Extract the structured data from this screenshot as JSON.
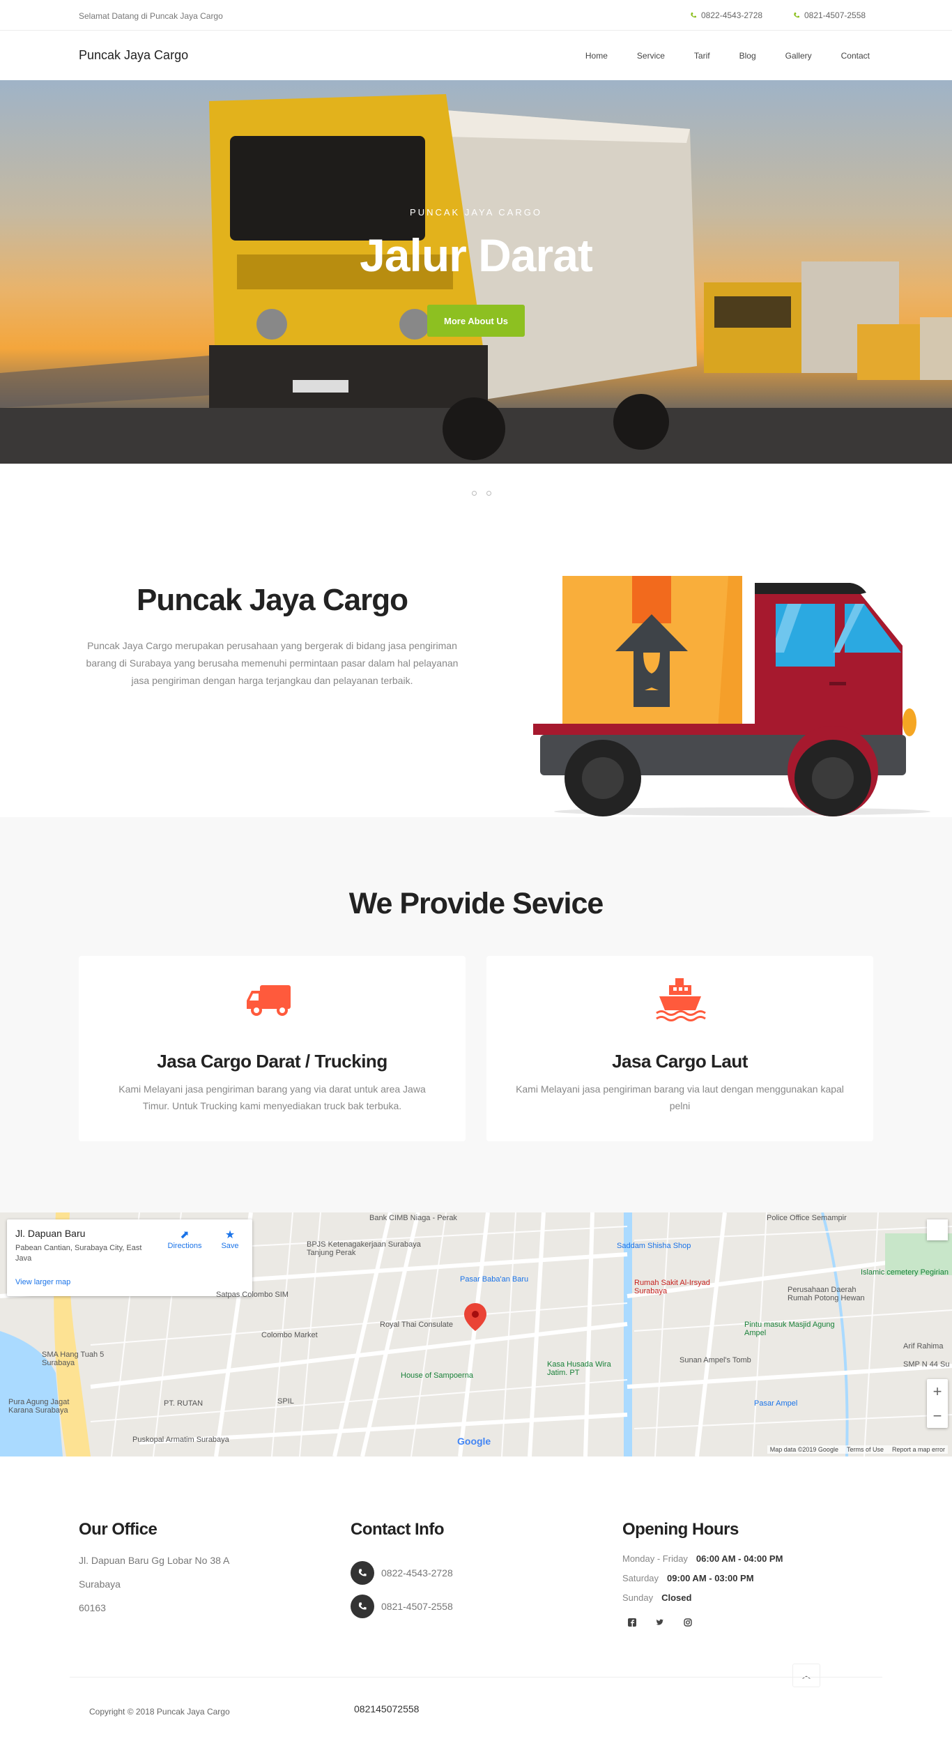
{
  "topbar": {
    "welcome": "Selamat Datang di Puncak Jaya Cargo",
    "phone1": "0822-4543-2728",
    "phone2": "0821-4507-2558"
  },
  "nav": {
    "brand": "Puncak Jaya Cargo",
    "items": [
      "Home",
      "Service",
      "Tarif",
      "Blog",
      "Gallery",
      "Contact"
    ]
  },
  "hero": {
    "kicker": "PUNCAK JAYA CARGO",
    "title": "Jalur Darat",
    "cta": "More About Us"
  },
  "about": {
    "title": "Puncak Jaya Cargo",
    "text": "Puncak Jaya Cargo merupakan perusahaan yang bergerak di bidang jasa pengiriman barang di Surabaya yang berusaha memenuhi permintaan pasar dalam hal pelayanan jasa pengiriman dengan harga terjangkau dan pelayanan terbaik."
  },
  "services": {
    "heading": "We Provide Sevice",
    "cards": [
      {
        "icon": "truck-icon",
        "title": "Jasa Cargo Darat / Trucking",
        "text": "Kami Melayani jasa pengiriman barang yang via darat untuk area Jawa Timur. Untuk Trucking kami menyediakan truck bak terbuka."
      },
      {
        "icon": "ship-icon",
        "title": "Jasa Cargo Laut",
        "text": "Kami Melayani jasa pengiriman barang via laut dengan menggunakan kapal pelni"
      }
    ]
  },
  "map": {
    "place": "Jl. Dapuan Baru",
    "address": "Pabean Cantian, Surabaya City, East Java",
    "larger": "View larger map",
    "directions": "Directions",
    "save": "Save",
    "labels": [
      "Bank CIMB Niaga - Perak",
      "BPJS Ketenagakerjaan Surabaya Tanjung Perak",
      "Satpas Colombo SIM",
      "Colombo Market",
      "Royal Thai Consulate",
      "Pasar Baba'an Baru",
      "Saddam Shisha Shop",
      "Rumah Sakit Al-Irsyad Surabaya",
      "Perusahaan Daerah Rumah Potong Hewan",
      "Pintu masuk Masjid Agung Ampel",
      "Sunan Ampel's Tomb",
      "Kasa Husada Wira Jatim. PT",
      "House of Sampoerna",
      "SMA Hang Tuah 5 Surabaya",
      "Pura Agung Jagat Karana Surabaya",
      "PT. RUTAN",
      "SPIL",
      "Puskopal Armatim Surabaya",
      "Pasar Ampel",
      "Police Office Semampir",
      "Islamic cemetery Pegirian",
      "Arif Rahima",
      "SMP N 44 Su"
    ],
    "attribution": [
      "Map data ©2019 Google",
      "Terms of Use",
      "Report a map error"
    ],
    "google": "Google"
  },
  "footer": {
    "office": {
      "title": "Our Office",
      "lines": [
        "Jl. Dapuan Baru Gg Lobar No 38 A",
        "Surabaya",
        "60163"
      ]
    },
    "contact": {
      "title": "Contact Info",
      "phones": [
        "0822-4543-2728",
        "0821-4507-2558"
      ]
    },
    "hours": {
      "title": "Opening Hours",
      "rows": [
        {
          "day": "Monday - Friday",
          "time": "06:00 AM - 04:00 PM"
        },
        {
          "day": "Saturday",
          "time": "09:00 AM - 03:00 PM"
        },
        {
          "day": "Sunday",
          "time": "Closed"
        }
      ]
    },
    "social": [
      "facebook-icon",
      "twitter-icon",
      "instagram-icon"
    ],
    "copyright": "Copyright © 2018 Puncak Jaya Cargo",
    "number": "082145072558"
  },
  "colors": {
    "accent_green": "#8dc021",
    "service_icon": "#ff5a3c",
    "phone_icon": "#8dc021"
  }
}
